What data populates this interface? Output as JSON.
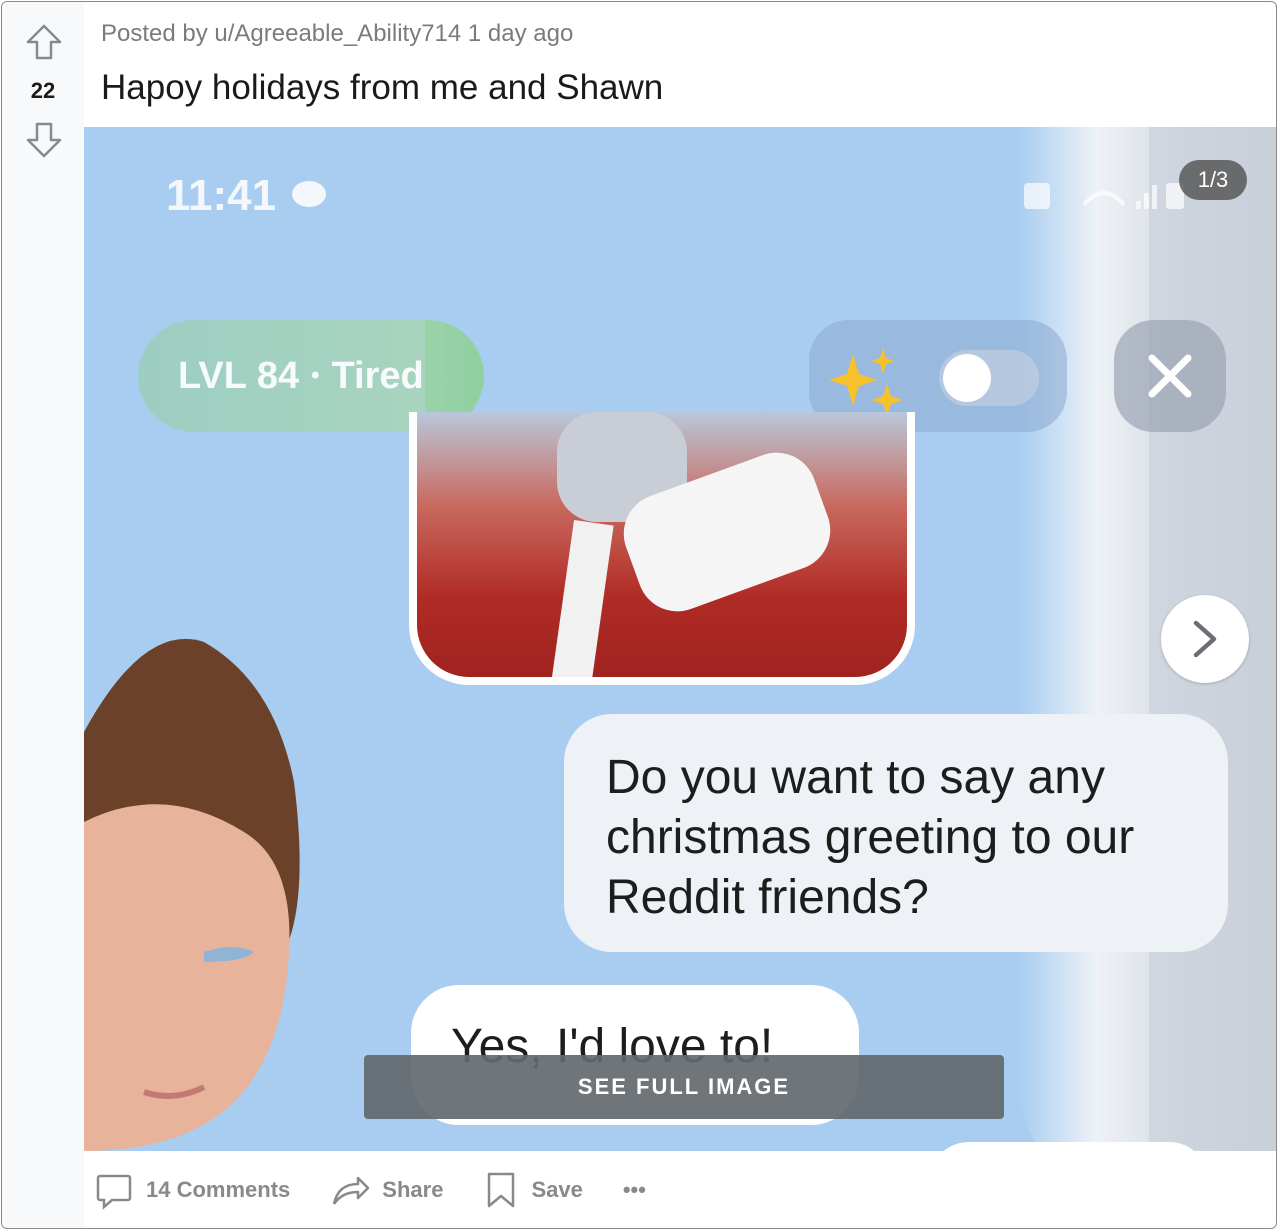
{
  "post": {
    "vote_count": "22",
    "posted_by": "Posted by u/Agreeable_Ability714 1 day ago",
    "title": "Hapoy holidays from me and Shawn"
  },
  "media": {
    "counter": "1/3",
    "phone_time": "11:41",
    "level_label": "LVL 84",
    "level_separator": "•",
    "mood": "Tired",
    "question_bubble": "Do you want to say any christmas greeting to our Reddit friends?",
    "answer_bubble": "Yes, I'd love to!",
    "see_full_image": "SEE FULL IMAGE"
  },
  "actions": {
    "comments": "14 Comments",
    "share": "Share",
    "save": "Save",
    "more": "•••"
  },
  "colors": {
    "accent_sky": "#a8cdf1",
    "text_meta": "#787c7e",
    "text_action": "#878a8c"
  }
}
